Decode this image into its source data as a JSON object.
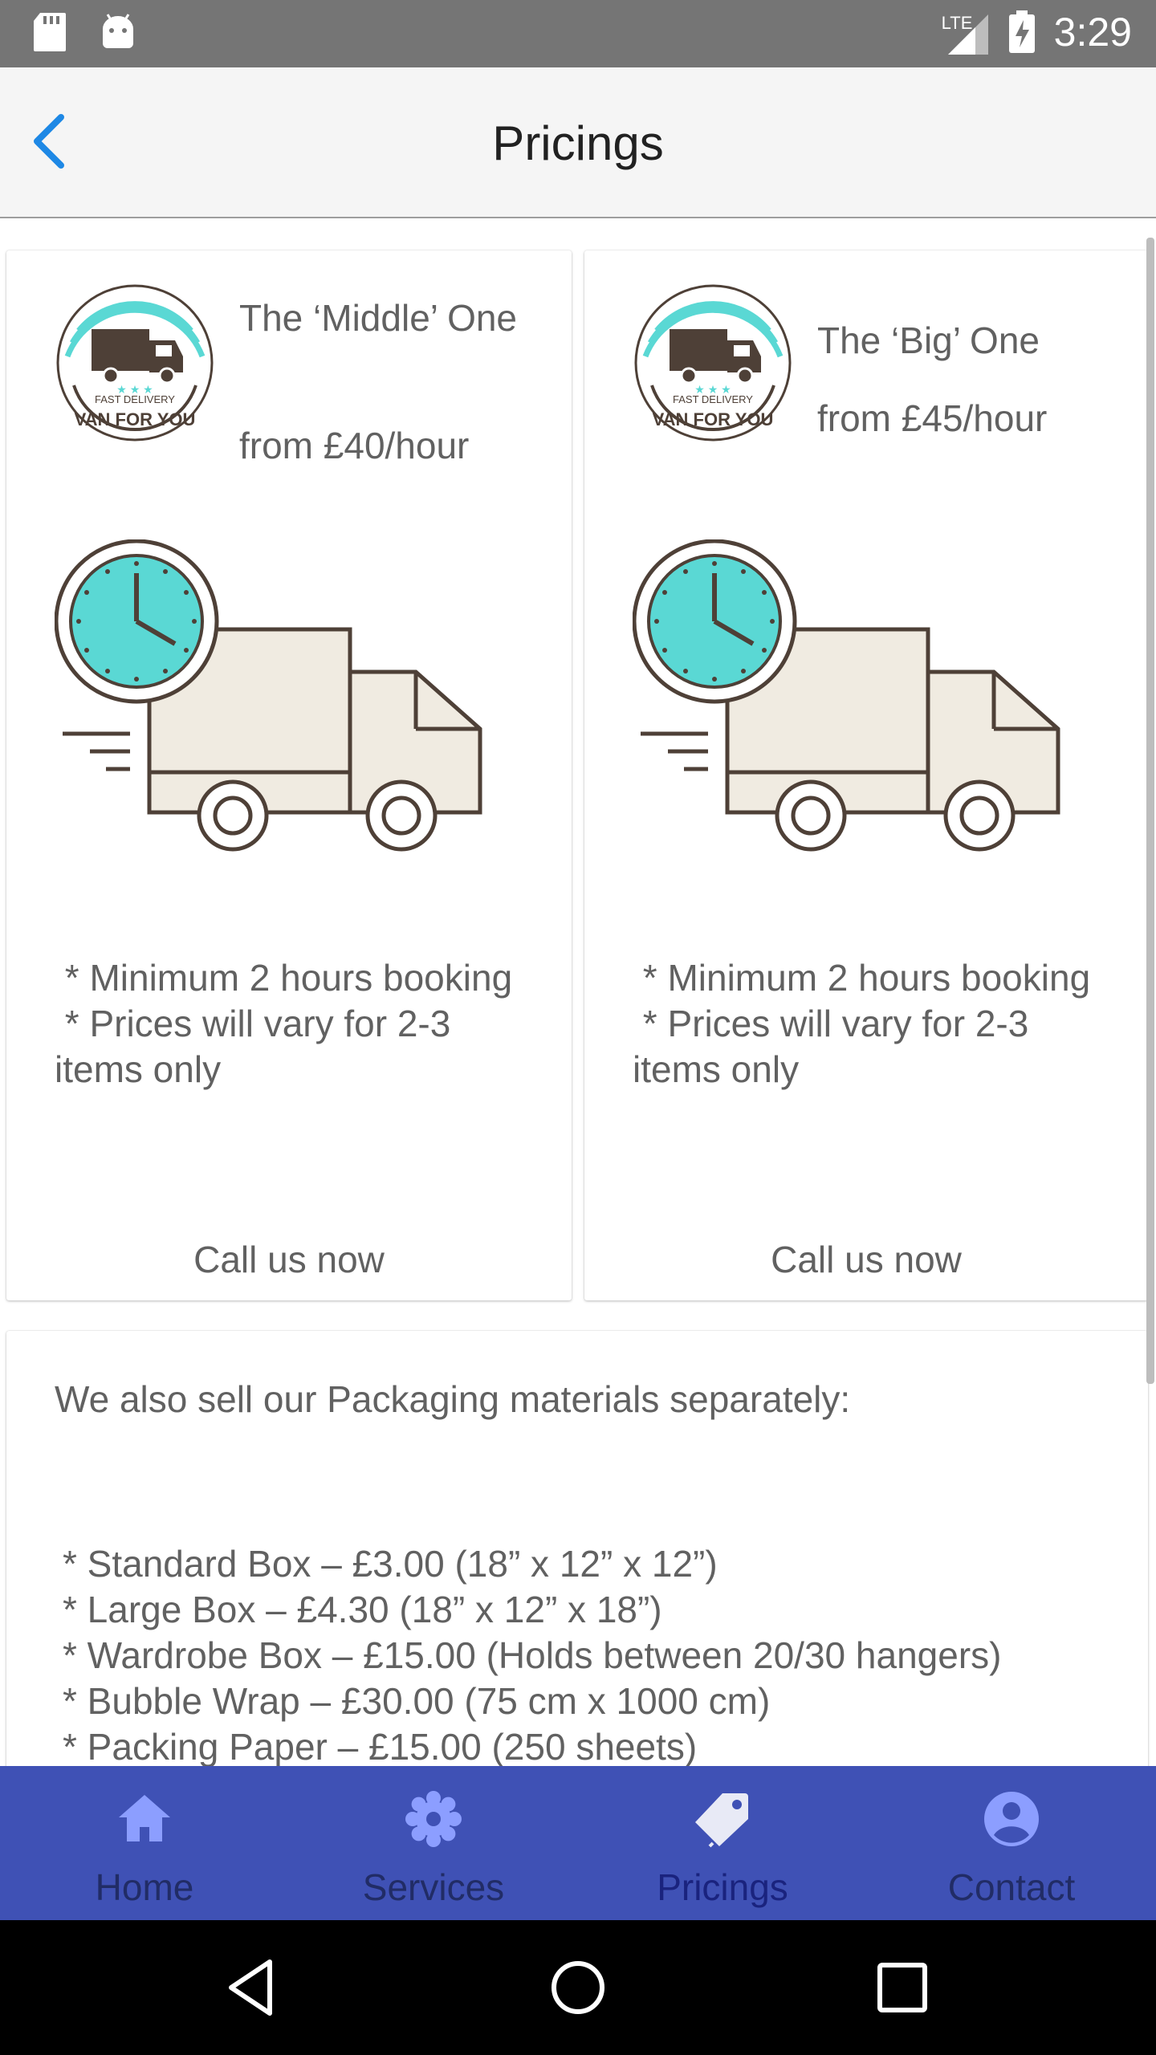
{
  "status_bar": {
    "time": "3:29",
    "network": "LTE",
    "icons": [
      "sd-card-icon",
      "android-icon",
      "signal-icon",
      "battery-charging-icon"
    ]
  },
  "app_bar": {
    "title": "Pricings",
    "back_icon": "chevron-left-icon",
    "back_color": "#1e88e5"
  },
  "cards": [
    {
      "title": "The ‘Middle’ One",
      "price": "from £40/hour",
      "logo_text_top": "FAST DELIVERY",
      "logo_text_bottom": "VAN FOR YOU",
      "notes": [
        " * Minimum 2 hours booking",
        " * Prices will vary for 2-3 items only"
      ],
      "action_label": "Call us now"
    },
    {
      "title": "The ‘Big’ One",
      "price": "from £45/hour",
      "logo_text_top": "FAST DELIVERY",
      "logo_text_bottom": "VAN FOR YOU",
      "notes": [
        " * Minimum 2 hours booking",
        " * Prices will vary for 2-3 items only"
      ],
      "action_label": "Call us now"
    }
  ],
  "packaging": {
    "heading": "We also sell our Packaging materials separately:",
    "items": [
      "* Standard Box – £3.00 (18” x 12” x 12”)",
      "* Large Box – £4.30 (18” x 12” x 18”)",
      "* Wardrobe Box – £15.00 (Holds between 20/30 hangers)",
      "* Bubble Wrap – £30.00 (75 cm x 1000 cm)",
      "* Packing Paper – £15.00 (250 sheets)"
    ]
  },
  "bottom_nav": {
    "items": [
      {
        "label": "Home",
        "icon": "home-icon"
      },
      {
        "label": "Services",
        "icon": "gear-icon"
      },
      {
        "label": "Pricings",
        "icon": "tag-icon",
        "active": true
      },
      {
        "label": "Contact",
        "icon": "account-circle-icon"
      }
    ],
    "background": "#3f51b5",
    "icon_color": "#8c9eff",
    "active_icon_color": "#e8eaf6"
  },
  "colors": {
    "accent_teal": "#5ad8d4",
    "truck_outline": "#4e4037",
    "truck_fill": "#f0ebe1"
  }
}
